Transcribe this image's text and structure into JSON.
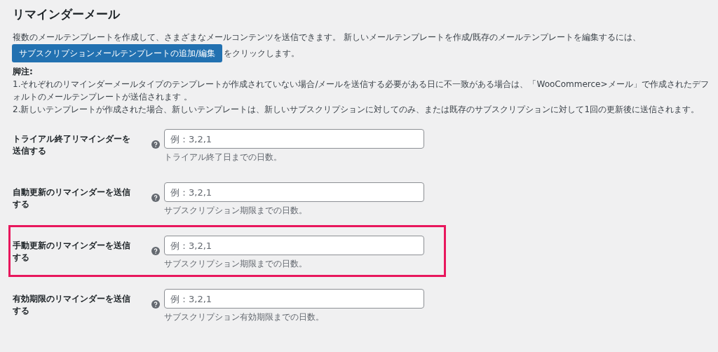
{
  "title": "リマインダーメール",
  "intro": "複数のメールテンプレートを作成して、さまざまなメールコンテンツを送信できます。 新しいメールテンプレートを作成/既存のメールテンプレートを編集するには、",
  "add_button": "サブスクリプションメールテンプレートの追加/編集",
  "button_suffix": "をクリックします。",
  "footnote_label": "脚注:",
  "footnotes": [
    "1.それぞれのリマインダーメールタイプのテンプレートが作成されていない場合/メールを送信する必要がある日に不一致がある場合は、「WooCommerce>メール」で作成されたデフォルトのメールテンプレートが送信されます 。",
    "2.新しいテンプレートが作成された場合、新しいテンプレートは、新しいサブスクリプションに対してのみ、または既存のサブスクリプションに対して1回の更新後に送信されます。"
  ],
  "settings": [
    {
      "label": "トライアル終了リマインダーを送信する",
      "placeholder": "例：3,2,1",
      "description": "トライアル終了日までの日数。",
      "highlighted": false
    },
    {
      "label": "自動更新のリマインダーを送信する",
      "placeholder": "例：3,2,1",
      "description": "サブスクリプション期限までの日数。",
      "highlighted": false
    },
    {
      "label": "手動更新のリマインダーを送信する",
      "placeholder": "例：3,2,1",
      "description": "サブスクリプション期限までの日数。",
      "highlighted": true
    },
    {
      "label": "有効期限のリマインダーを送信する",
      "placeholder": "例：3,2,1",
      "description": "サブスクリプション有効期限までの日数。",
      "highlighted": false
    }
  ]
}
